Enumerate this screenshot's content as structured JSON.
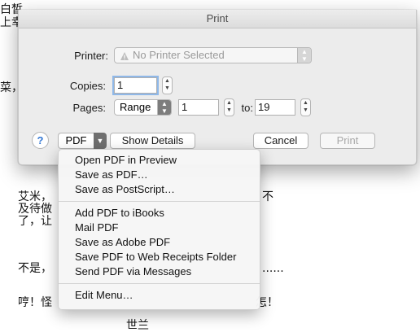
{
  "background_doc": {
    "lines": [
      "白皙",
      "上幸",
      "菜，",
      "艾米，",
      "不",
      "及待做",
      "了，让",
      "不是，",
      "......",
      "哼！怪",
      "怎！",
      "世兰"
    ]
  },
  "dialog": {
    "title": "Print",
    "printer_label": "Printer:",
    "printer_value": "No Printer Selected",
    "copies_label": "Copies:",
    "copies_value": "1",
    "pages_label": "Pages:",
    "pages_mode": "Range",
    "pages_from": "1",
    "pages_to_label": "to:",
    "pages_to": "19",
    "help_label": "?",
    "pdf_label": "PDF",
    "show_details_label": "Show Details",
    "cancel_label": "Cancel",
    "print_label": "Print"
  },
  "pdf_menu": {
    "group1": [
      "Open PDF in Preview",
      "Save as PDF…",
      "Save as PostScript…"
    ],
    "group2": [
      "Add PDF to iBooks",
      "Mail PDF",
      "Save as Adobe PDF",
      "Save PDF to Web Receipts Folder",
      "Send PDF via Messages"
    ],
    "group3": [
      "Edit Menu…"
    ]
  },
  "icons": {
    "warning": "warning-triangle-icon",
    "updown": "updown-arrows-icon",
    "chevron": "chevron-down-icon"
  }
}
